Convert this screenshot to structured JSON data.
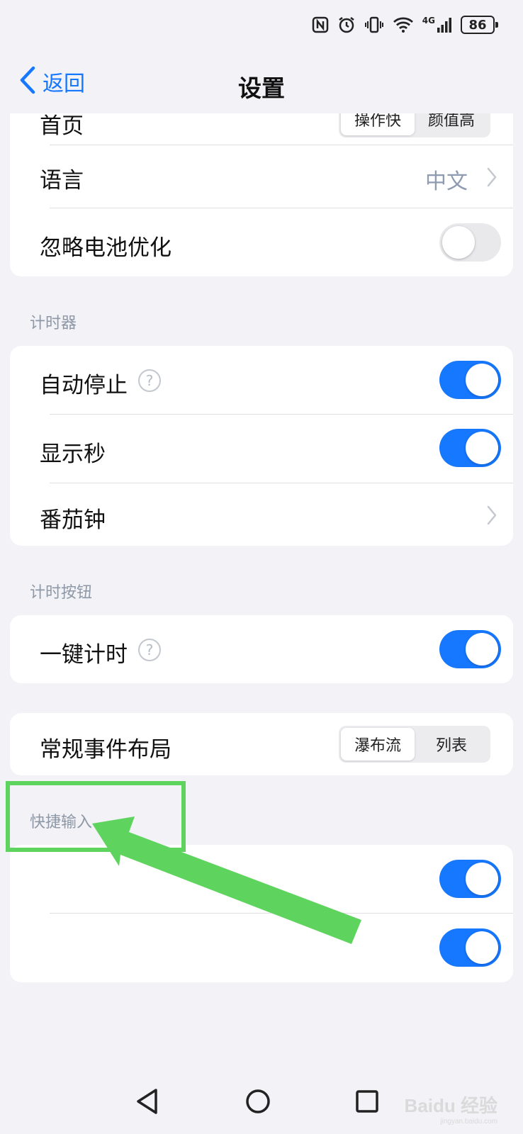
{
  "status_bar": {
    "icons": [
      "nfc-icon",
      "alarm-icon",
      "vibrate-icon",
      "wifi-icon",
      "signal-4g-icon"
    ],
    "network_label": "4G",
    "battery": "86"
  },
  "nav": {
    "back_label": "返回",
    "title": "设置"
  },
  "general": {
    "home": {
      "label": "首页",
      "segments": [
        "操作快",
        "颜值高"
      ],
      "selected": "操作快"
    },
    "language": {
      "label": "语言",
      "value": "中文"
    },
    "ignore_battery": {
      "label": "忽略电池优化",
      "enabled": false
    }
  },
  "timer": {
    "section_title": "计时器",
    "auto_stop": {
      "label": "自动停止",
      "enabled": true
    },
    "show_seconds": {
      "label": "显示秒",
      "enabled": true
    },
    "pomodoro": {
      "label": "番茄钟"
    }
  },
  "timer_button": {
    "section_title": "计时按钮",
    "one_tap": {
      "label": "一键计时",
      "enabled": true
    }
  },
  "event_layout": {
    "label": "常规事件布局",
    "segments": [
      "瀑布流",
      "列表"
    ],
    "selected": "瀑布流"
  },
  "quick_input": {
    "section_title": "快捷输入",
    "toggles": [
      {
        "enabled": true
      },
      {
        "enabled": true
      }
    ]
  },
  "annotation": {
    "color": "#5ed45e"
  },
  "watermark": {
    "text": "Baidu 经验",
    "sub": "jingyan.baidu.com"
  },
  "colors": {
    "accent": "#1677ff",
    "toggle_off": "#e9e9ec",
    "section_title": "#8e98a6"
  }
}
